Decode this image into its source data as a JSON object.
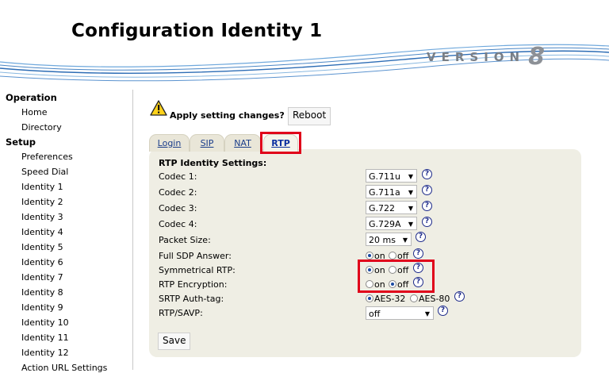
{
  "header": {
    "title": "Configuration Identity 1",
    "version_label": "VERSION",
    "version_number": "8"
  },
  "sidebar": {
    "operation": "Operation",
    "setup": "Setup",
    "operation_items": [
      "Home",
      "Directory"
    ],
    "setup_items": [
      "Preferences",
      "Speed Dial",
      "Identity 1",
      "Identity 2",
      "Identity 3",
      "Identity 4",
      "Identity 5",
      "Identity 6",
      "Identity 7",
      "Identity 8",
      "Identity 9",
      "Identity 10",
      "Identity 11",
      "Identity 12",
      "Action URL Settings"
    ]
  },
  "apply": {
    "text": "Apply setting changes?",
    "reboot_label": "Reboot"
  },
  "tabs": [
    "Login",
    "SIP",
    "NAT",
    "RTP"
  ],
  "active_tab": "RTP",
  "panel": {
    "title": "RTP Identity Settings:",
    "codec1_label": "Codec 1:",
    "codec1_value": "G.711u",
    "codec2_label": "Codec 2:",
    "codec2_value": "G.711a",
    "codec3_label": "Codec 3:",
    "codec3_value": "G.722",
    "codec4_label": "Codec 4:",
    "codec4_value": "G.729A",
    "packet_label": "Packet Size:",
    "packet_value": "20 ms",
    "sdp_label": "Full SDP Answer:",
    "sdp_value": "on",
    "sym_label": "Symmetrical RTP:",
    "sym_value": "on",
    "enc_label": "RTP Encryption:",
    "enc_value": "off",
    "srtp_label": "SRTP Auth-tag:",
    "srtp_value": "AES-32",
    "savp_label": "RTP/SAVP:",
    "savp_value": "off",
    "on_text": "on",
    "off_text": "off",
    "aes32_text": "AES-32",
    "aes80_text": "AES-80",
    "save_label": "Save"
  },
  "colors": {
    "highlight": "#e0001a",
    "panel": "#efeee4",
    "link": "#1a3d8a"
  },
  "icons": {
    "warning": "warning-icon",
    "help": "help-icon"
  }
}
